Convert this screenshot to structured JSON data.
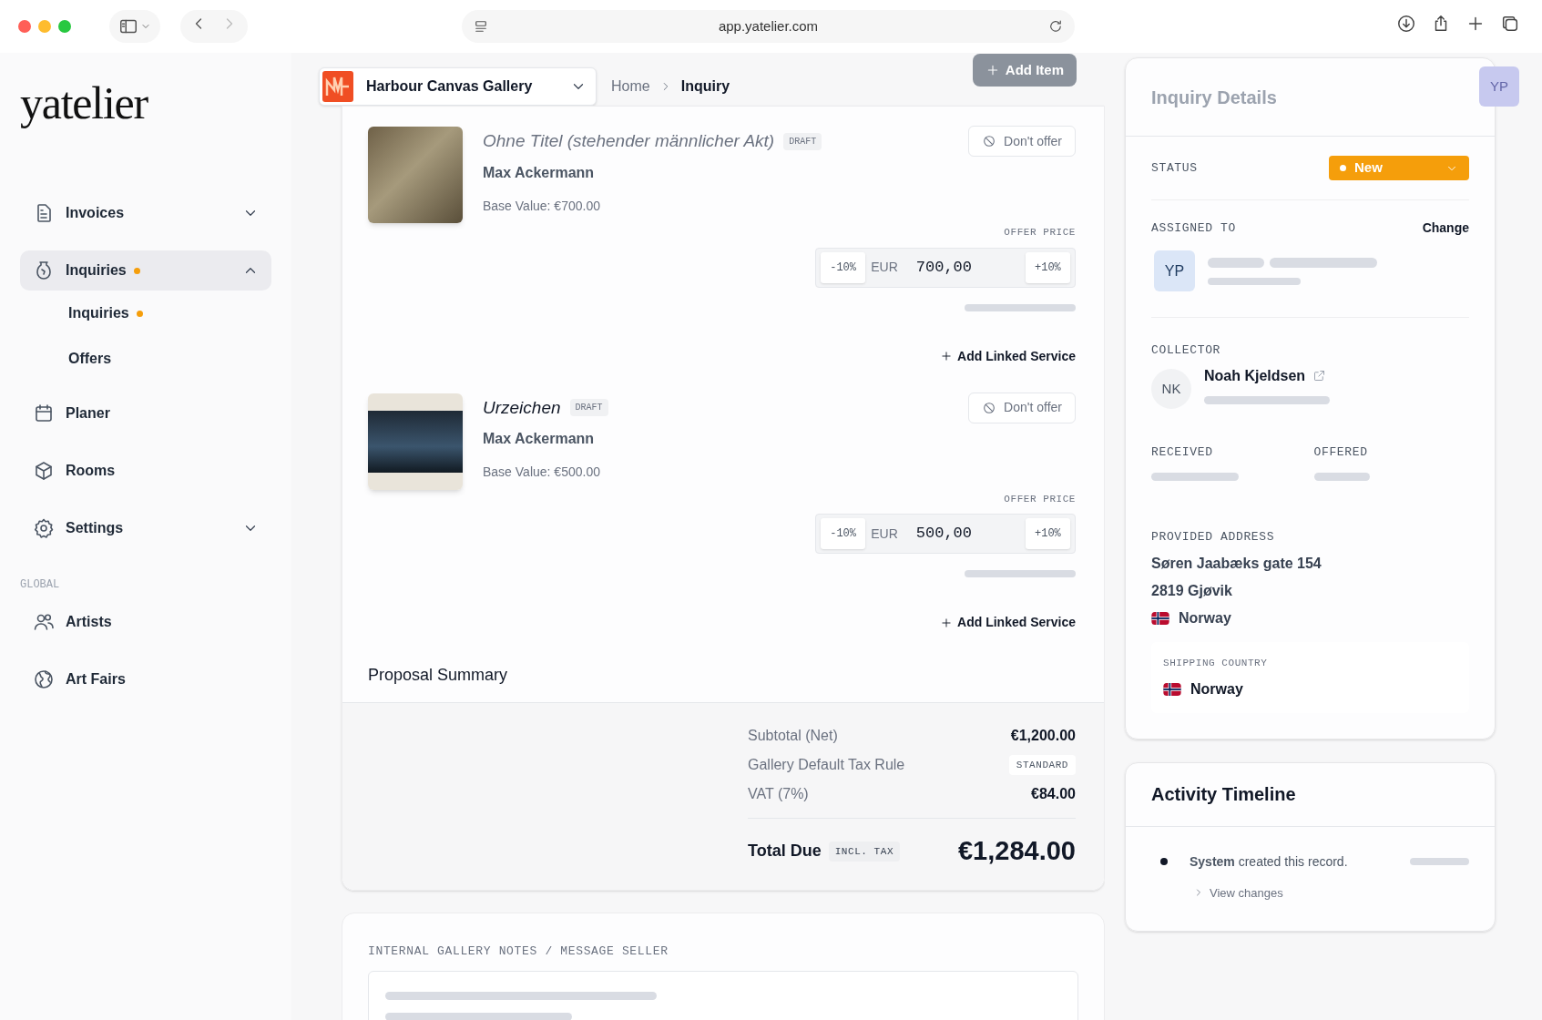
{
  "browser": {
    "url": "app.yatelier.com"
  },
  "sidebar": {
    "logo": "yatelier",
    "items": [
      {
        "kind": "group",
        "label": "Invoices",
        "dot": false,
        "selected": false,
        "expanded": false
      },
      {
        "kind": "group",
        "label": "Inquiries",
        "dot": true,
        "selected": true,
        "expanded": true,
        "children": [
          {
            "label": "Inquiries",
            "dot": true
          },
          {
            "label": "Offers",
            "dot": false
          }
        ]
      },
      {
        "kind": "link",
        "label": "Planer",
        "dot": false,
        "selected": false
      },
      {
        "kind": "link",
        "label": "Rooms",
        "dot": false,
        "selected": false
      },
      {
        "kind": "group",
        "label": "Settings",
        "dot": false,
        "selected": false,
        "expanded": false
      },
      {
        "kind": "heading",
        "label": "GLOBAL"
      },
      {
        "kind": "link",
        "label": "Artists",
        "dot": false,
        "selected": false
      },
      {
        "kind": "link",
        "label": "Art Fairs",
        "dot": false,
        "selected": false
      }
    ]
  },
  "header": {
    "gallery": "Harbour Canvas Gallery",
    "breadcrumb": [
      "Home",
      "Inquiry"
    ],
    "add_button": "Add Item"
  },
  "items": [
    {
      "title": "Ohne Titel (stehender männlicher Akt)",
      "badge": "DRAFT",
      "artist": "Max Ackermann",
      "base_value": "Base Value: €700.00",
      "dont_offer": "Don't offer",
      "offer_label": "OFFER PRICE",
      "minus": "-10%",
      "currency": "EUR",
      "price": "700,00",
      "plus": "+10%",
      "add_service": "Add Linked Service"
    },
    {
      "title": "Urzeichen",
      "badge": "DRAFT",
      "artist": "Max Ackermann",
      "base_value": "Base Value: €500.00",
      "dont_offer": "Don't offer",
      "offer_label": "OFFER PRICE",
      "minus": "-10%",
      "currency": "EUR",
      "price": "500,00",
      "plus": "+10%",
      "add_service": "Add Linked Service"
    }
  ],
  "summary": {
    "title": "Proposal Summary",
    "rows": [
      {
        "kind": "amount",
        "label": "Subtotal (Net)",
        "value": "€1,200.00"
      },
      {
        "kind": "tag",
        "label": "Gallery Default Tax Rule",
        "value": "STANDARD"
      },
      {
        "kind": "amount",
        "label": "VAT (7%)",
        "value": "€84.00"
      }
    ],
    "total_label": "Total Due",
    "total_tag": "INCL. TAX",
    "total": "€1,284.00"
  },
  "notes": {
    "label": "INTERNAL GALLERY NOTES / MESSAGE SELLER"
  },
  "details": {
    "title": "Inquiry Details",
    "status_label": "STATUS",
    "status": "New",
    "assigned_label": "ASSIGNED TO",
    "change": "Change",
    "assignee_initials": "YP",
    "collector_label": "COLLECTOR",
    "collector_initials": "NK",
    "collector": "Noah Kjeldsen",
    "received_label": "RECEIVED",
    "offered_label": "OFFERED",
    "address_label": "PROVIDED ADDRESS",
    "address": [
      "Søren Jaabæks gate 154",
      "2819 Gjøvik"
    ],
    "country": "Norway",
    "shipping_label": "SHIPPING COUNTRY",
    "shipping_country": "Norway"
  },
  "timeline": {
    "title": "Activity Timeline",
    "entries": [
      {
        "text": "**System** created this record.",
        "link": "View changes"
      }
    ]
  },
  "user": {
    "initials": "YP"
  }
}
